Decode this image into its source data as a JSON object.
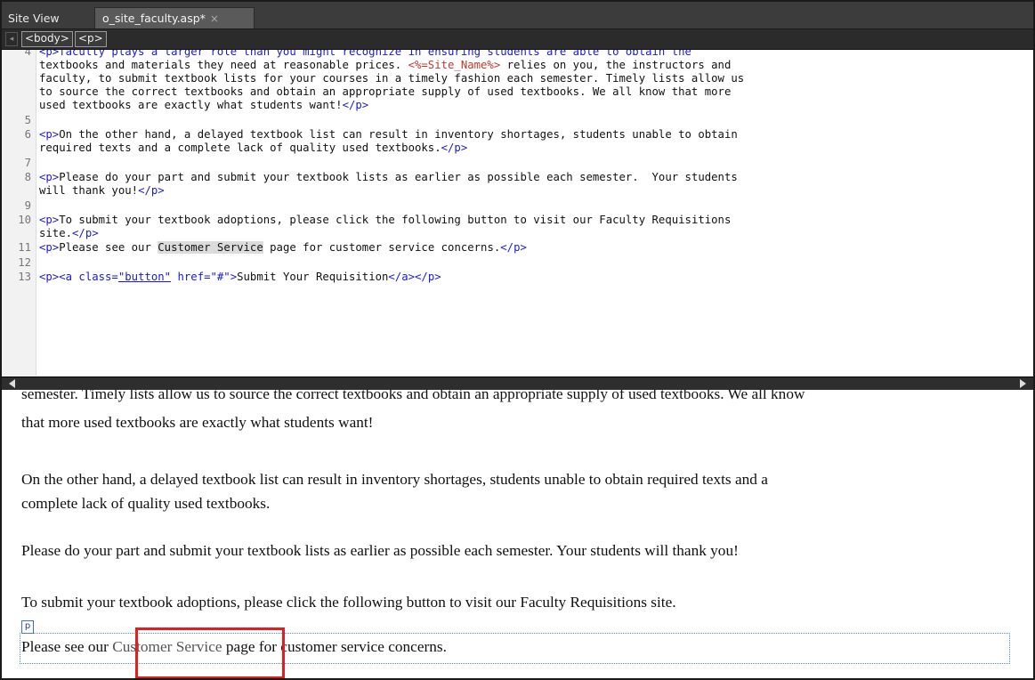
{
  "tabs": {
    "site_view": "Site View",
    "document": "o_site_faculty.asp*",
    "close": "×"
  },
  "tag_selector": {
    "arrow": "◂",
    "body": "<body>",
    "p": "<p>"
  },
  "code": {
    "lines": [
      {
        "n": "4",
        "parts": [
          {
            "t": "<p>faculty plays a larger role than you might recognize in ensuring students are able to obtain the",
            "c": "tagc"
          }
        ]
      },
      {
        "n": "",
        "parts": [
          {
            "t": "textbooks and materials they need at reasonable prices. "
          },
          {
            "t": "<%=Site_Name%>",
            "c": "aspc"
          },
          {
            "t": " relies on you, the instructors and"
          }
        ]
      },
      {
        "n": "",
        "parts": [
          {
            "t": "faculty, to submit textbook lists for your courses in a timely fashion each semester. Timely lists allow us"
          }
        ]
      },
      {
        "n": "",
        "parts": [
          {
            "t": "to source the correct textbooks and obtain an appropriate supply of used textbooks. We all know that more"
          }
        ]
      },
      {
        "n": "",
        "parts": [
          {
            "t": "used textbooks are exactly what students want!"
          },
          {
            "t": "</p>",
            "c": "tagc"
          }
        ]
      },
      {
        "n": "5",
        "parts": []
      },
      {
        "n": "6",
        "parts": [
          {
            "t": "<p>",
            "c": "tagc"
          },
          {
            "t": "On the other hand, a delayed textbook list can result in inventory shortages, students unable to obtain"
          }
        ]
      },
      {
        "n": "",
        "parts": [
          {
            "t": "required texts and a complete lack of quality used textbooks."
          },
          {
            "t": "</p>",
            "c": "tagc"
          }
        ]
      },
      {
        "n": "7",
        "parts": []
      },
      {
        "n": "8",
        "parts": [
          {
            "t": "<p>",
            "c": "tagc"
          },
          {
            "t": "Please do your part and submit your textbook lists as earlier as possible each semester.  Your students"
          }
        ]
      },
      {
        "n": "",
        "parts": [
          {
            "t": "will thank you!"
          },
          {
            "t": "</p>",
            "c": "tagc"
          }
        ]
      },
      {
        "n": "9",
        "parts": []
      },
      {
        "n": "10",
        "parts": [
          {
            "t": "<p>",
            "c": "tagc"
          },
          {
            "t": "To submit your textbook adoptions, please click the following button to visit our Faculty Requisitions"
          }
        ]
      },
      {
        "n": "",
        "parts": [
          {
            "t": "site."
          },
          {
            "t": "</p>",
            "c": "tagc"
          }
        ]
      },
      {
        "n": "11",
        "parts": [
          {
            "t": "<p>",
            "c": "tagc"
          },
          {
            "t": "Please see our "
          },
          {
            "t": "Customer Service",
            "c": "selc"
          },
          {
            "t": " page for customer service concerns."
          },
          {
            "t": "</p>",
            "c": "tagc"
          }
        ]
      },
      {
        "n": "12",
        "parts": []
      },
      {
        "n": "13",
        "parts": [
          {
            "t": "<p><a class=",
            "c": "tagc"
          },
          {
            "t": "\"button\"",
            "c": "valc"
          },
          {
            "t": " href=\"#\">",
            "c": "tagc"
          },
          {
            "t": "Submit Your Requisition"
          },
          {
            "t": "</a></p>",
            "c": "tagc"
          }
        ]
      }
    ]
  },
  "design": {
    "cut_line": "semester. Timely lists allow us to source the correct textbooks and obtain an appropriate supply of used textbooks. We all know",
    "line_a": "that more used textbooks are exactly what students want!",
    "line_b1": "On the other hand, a delayed textbook list can result in inventory shortages, students unable to obtain required texts and a",
    "line_b2": "complete lack of quality used textbooks.",
    "line_c": "Please do your part and submit your textbook lists as earlier as possible each semester. Your students will thank you!",
    "line_d": "To submit your textbook adoptions, please click the following button to visit our Faculty Requisitions site.",
    "p_badge": "p",
    "cs_pre": "Please see our ",
    "cs_link": "Customer Service",
    "cs_post": " page for customer service concerns."
  }
}
